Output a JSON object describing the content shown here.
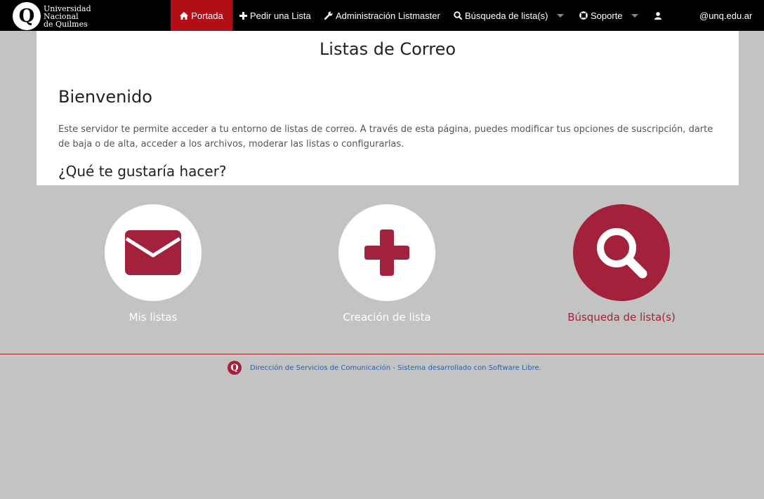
{
  "brand": {
    "logo_letter": "Q",
    "line1": "Universidad",
    "line2": "Nacional",
    "line3": "de Quilmes"
  },
  "nav": {
    "home": "Portada",
    "request_list": "Pedir una Lista",
    "listmaster_admin": "Administración Listmaster",
    "search_lists": "Búsqueda de lista(s)",
    "support": "Soporte",
    "user_email": "@unq.edu.ar"
  },
  "panel": {
    "title": "Listas de Correo",
    "welcome": "Bienvenido",
    "intro": "Este servidor te permite acceder a tu entorno de listas de correo. A través de esta página, puedes modificar tus opciones de suscripción, darte de baja o de alta, acceder a los archivos, moderar las listas o configurarlas.",
    "question": "¿Qué te gustaría hacer?"
  },
  "actions": {
    "my_lists": "Mis listas",
    "create_list": "Creación de lista",
    "search_lists": "Búsqueda de lista(s)"
  },
  "footer": {
    "text": "Dirección de Servicios de Comunicación - Sistema desarrollado con Software Libre."
  },
  "colors": {
    "accent": "#a3213a",
    "nav_active": "#b30d17",
    "background": "#c3c3c3",
    "link": "#2a5fa8"
  },
  "icons": {
    "home": "home-icon",
    "plus": "plus-icon",
    "wrench": "wrench-icon",
    "search": "search-icon",
    "lifebuoy": "lifebuoy-icon",
    "user": "user-icon",
    "envelope": "envelope-icon"
  }
}
